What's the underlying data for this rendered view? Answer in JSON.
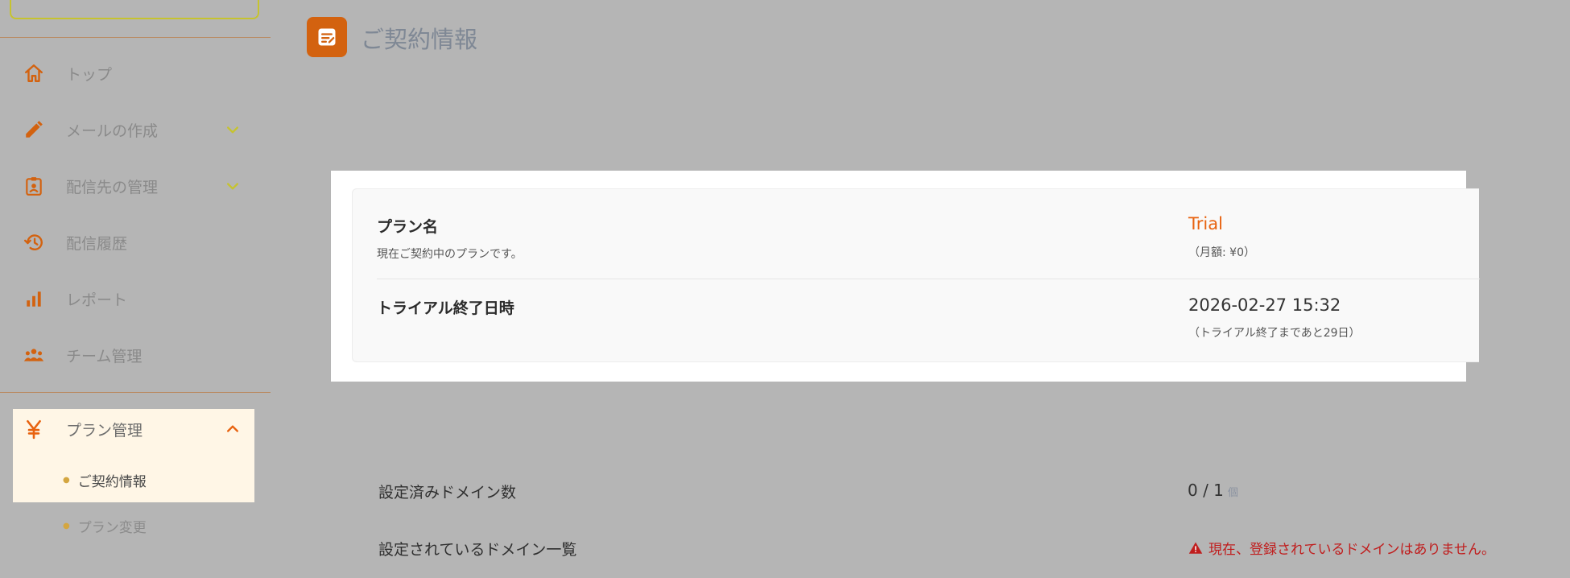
{
  "colors": {
    "accent": "#e8620f",
    "icon_orange": "#d3620f",
    "chevron_yellow": "#c6c32f",
    "alert_red": "#c01d1d",
    "overlay_gray": "#b5b5b5"
  },
  "sidebar": {
    "items": [
      {
        "label": "トップ",
        "icon": "home-icon"
      },
      {
        "label": "メールの作成",
        "icon": "pencil-icon",
        "expandable": true
      },
      {
        "label": "配信先の管理",
        "icon": "contact-badge-icon",
        "expandable": true
      },
      {
        "label": "配信履歴",
        "icon": "history-icon"
      },
      {
        "label": "レポート",
        "icon": "bar-chart-icon"
      },
      {
        "label": "チーム管理",
        "icon": "team-icon"
      }
    ],
    "plan_group": {
      "label": "プラン管理",
      "icon": "yen-icon",
      "expanded": true,
      "children": [
        {
          "label": "ご契約情報",
          "active": true
        },
        {
          "label": "プラン変更",
          "active": false
        }
      ]
    }
  },
  "header": {
    "title": "ご契約情報",
    "icon": "note-icon"
  },
  "contract": {
    "plan": {
      "label": "プラン名",
      "description": "現在ご契約中のプランです。",
      "value": "Trial",
      "sub": "（月額: ¥0）"
    },
    "trial_end": {
      "label": "トライアル終了日時",
      "value": "2026-02-27 15:32",
      "sub": "（トライアル終了まであと29日）"
    }
  },
  "domains": {
    "count_label": "設定済みドメイン数",
    "count_value": "0 / 1",
    "count_unit": "個",
    "list_label": "設定されているドメイン一覧",
    "empty_message": "現在、登録されているドメインはありません。"
  }
}
